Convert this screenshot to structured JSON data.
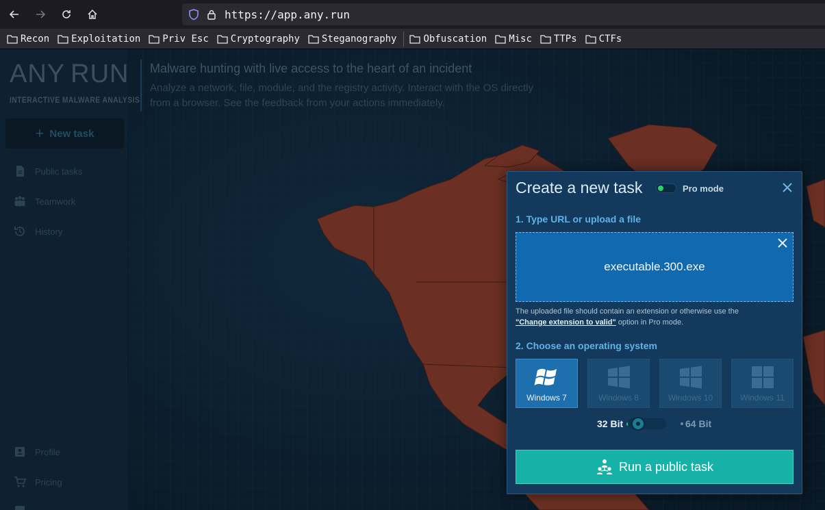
{
  "browser": {
    "url": "https://app.any.run",
    "bookmarks": [
      "Recon",
      "Exploitation",
      "Priv Esc",
      "Cryptography",
      "Steganography",
      "Obfuscation",
      "Misc",
      "TTPs",
      "CTFs"
    ]
  },
  "app": {
    "logo_left": "ANY",
    "logo_right": "RUN",
    "logo_sub": "INTERACTIVE MALWARE ANALYSIS",
    "new_task_label": "New task",
    "nav": {
      "public_tasks": "Public tasks",
      "teamwork": "Teamwork",
      "history": "History",
      "profile": "Profile",
      "pricing": "Pricing"
    },
    "headline": "Malware hunting with live access to the heart of an incident",
    "subheadline": "Analyze a network, file, module, and the registry activity. Interact with the OS directly from a browser. See the feedback from your actions immediately."
  },
  "modal": {
    "title": "Create a new task",
    "pro_mode_label": "Pro mode",
    "step1_label": "1. Type URL or upload a file",
    "file_name": "executable.300.exe",
    "hint_prefix": "The uploaded file should contain an extension or otherwise use the",
    "hint_link": "\"Change extension to valid\"",
    "hint_suffix": " option in Pro mode.",
    "step2_label": "2. Choose an operating system",
    "os_options": [
      "Windows 7",
      "Windows 8",
      "Windows 10",
      "Windows 11"
    ],
    "bit_32_label": "32 Bit",
    "bit_64_label": "64 Bit",
    "run_button_label": "Run a public task"
  },
  "colors": {
    "accent": "#16b1a7",
    "modal_bg": "#133a5c",
    "dropzone": "#1169b0",
    "map_land": "#6b3023"
  }
}
